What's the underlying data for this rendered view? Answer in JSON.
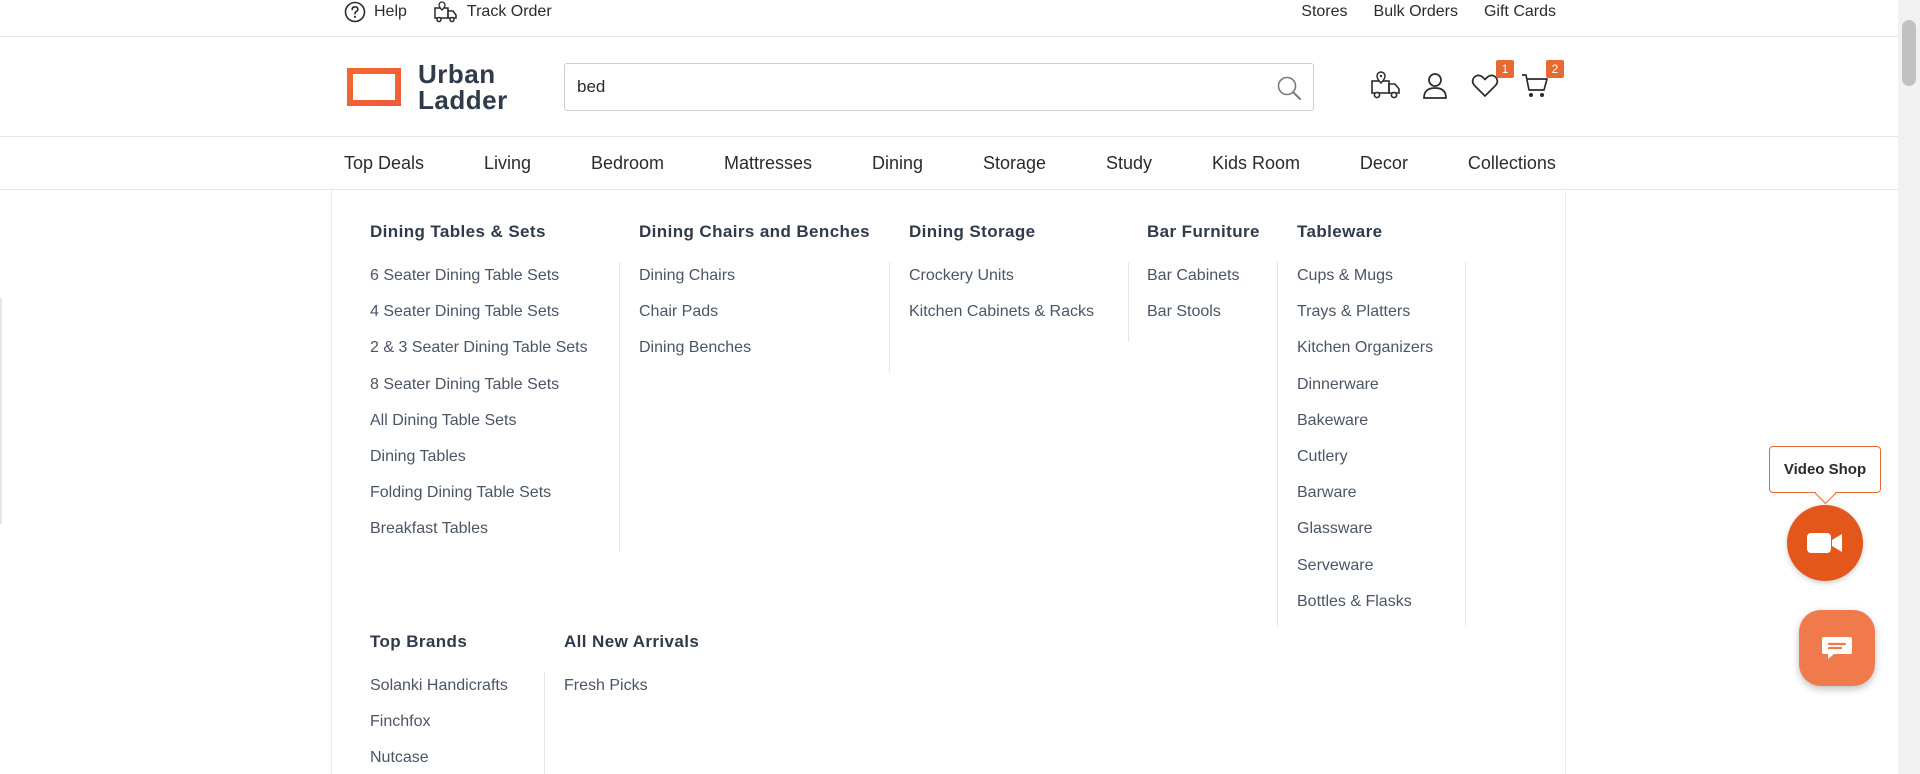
{
  "util": {
    "help": "Help",
    "track_order": "Track Order",
    "right_links": [
      "Stores",
      "Bulk Orders",
      "Gift Cards"
    ]
  },
  "logo": {
    "line1": "Urban",
    "line2": "Ladder"
  },
  "search": {
    "value": "bed"
  },
  "header_icons": {
    "wishlist_count": "1",
    "cart_count": "2"
  },
  "nav": [
    "Top Deals",
    "Living",
    "Bedroom",
    "Mattresses",
    "Dining",
    "Storage",
    "Study",
    "Kids Room",
    "Decor",
    "Collections"
  ],
  "mega": {
    "dining_tables": {
      "title": "Dining Tables & Sets",
      "links": [
        "6 Seater Dining Table Sets",
        "4 Seater Dining Table Sets",
        "2 & 3 Seater Dining Table Sets",
        "8 Seater Dining Table Sets",
        "All Dining Table Sets",
        "Dining Tables",
        "Folding Dining Table Sets",
        "Breakfast Tables"
      ]
    },
    "dining_chairs": {
      "title": "Dining Chairs and Benches",
      "links": [
        "Dining Chairs",
        "Chair Pads",
        "Dining Benches"
      ]
    },
    "dining_storage": {
      "title": "Dining Storage",
      "links": [
        "Crockery Units",
        "Kitchen Cabinets & Racks"
      ]
    },
    "bar_furniture": {
      "title": "Bar Furniture",
      "links": [
        "Bar Cabinets",
        "Bar Stools"
      ]
    },
    "tableware": {
      "title": "Tableware",
      "links": [
        "Cups & Mugs",
        "Trays & Platters",
        "Kitchen Organizers",
        "Dinnerware",
        "Bakeware",
        "Cutlery",
        "Barware",
        "Glassware",
        "Serveware",
        "Bottles & Flasks"
      ]
    },
    "top_brands": {
      "title": "Top Brands",
      "links": [
        "Solanki Handicrafts",
        "Finchfox",
        "Nutcase"
      ]
    },
    "new_arrivals": {
      "title": "All New Arrivals",
      "links": [
        "Fresh Picks"
      ]
    }
  },
  "widgets": {
    "video_shop": "Video Shop"
  },
  "colors": {
    "accent": "#e86a33",
    "text": "#2b2b2b",
    "heading": "#2f3b4b"
  }
}
